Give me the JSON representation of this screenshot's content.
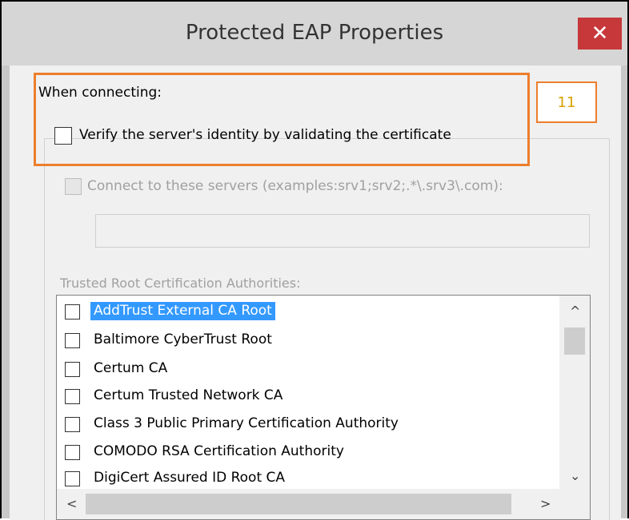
{
  "window": {
    "title": "Protected EAP Properties",
    "close_glyph": "✕"
  },
  "when_connecting_label": "When connecting:",
  "verify_checkbox": {
    "label": "Verify the server's identity by validating the certificate",
    "checked": false
  },
  "annotation": {
    "number": "11",
    "color": "#ec7e2d"
  },
  "connect_servers": {
    "label": "Connect to these servers (examples:srv1;srv2;.*\\.srv3\\.com):",
    "value": "",
    "enabled": false
  },
  "trusted_root_label": "Trusted Root Certification Authorities:",
  "ca_list": [
    {
      "label": "AddTrust External CA Root",
      "checked": false,
      "selected": true
    },
    {
      "label": "Baltimore CyberTrust Root",
      "checked": false,
      "selected": false
    },
    {
      "label": "Certum CA",
      "checked": false,
      "selected": false
    },
    {
      "label": "Certum Trusted Network CA",
      "checked": false,
      "selected": false
    },
    {
      "label": "Class 3 Public Primary Certification Authority",
      "checked": false,
      "selected": false
    },
    {
      "label": "COMODO RSA Certification Authority",
      "checked": false,
      "selected": false
    },
    {
      "label": "DigiCert Assured ID Root CA",
      "checked": false,
      "selected": false
    }
  ],
  "scrollbars": {
    "up": "^",
    "down": "⌄",
    "left": "<",
    "right": ">"
  }
}
